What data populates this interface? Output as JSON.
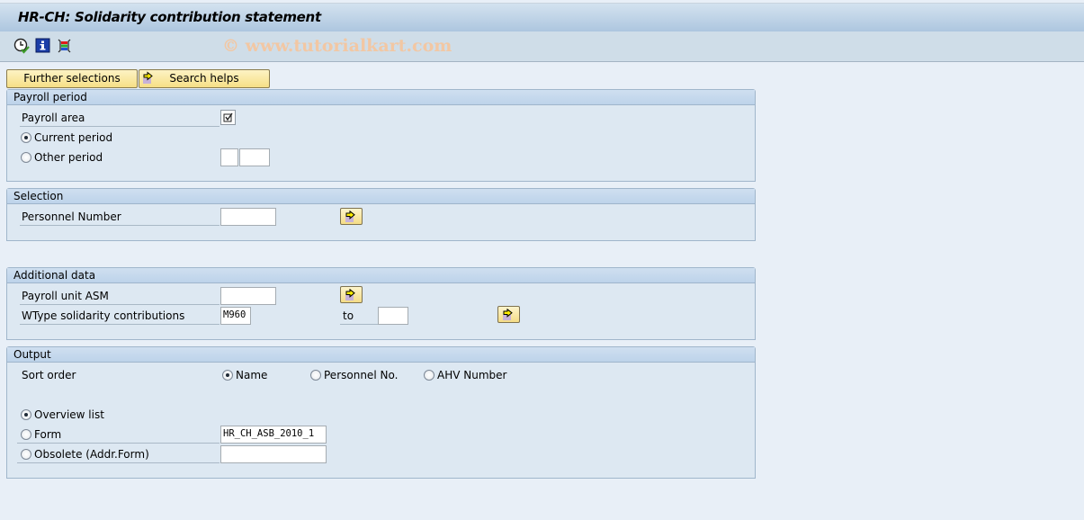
{
  "window": {
    "title": "HR-CH: Solidarity contribution statement",
    "watermark": "© www.tutorialkart.com"
  },
  "toolbar": {
    "icons": [
      "execute-clock-icon",
      "info-icon",
      "selection-options-icon"
    ]
  },
  "top_buttons": {
    "further_selections": "Further selections",
    "search_helps": "Search helps"
  },
  "payroll_period": {
    "header": "Payroll period",
    "payroll_area_label": "Payroll area",
    "payroll_area_checked": true,
    "current_period_label": "Current period",
    "current_period_selected": true,
    "other_period_label": "Other period",
    "other_period_selected": false,
    "other_period_value1": "",
    "other_period_value2": ""
  },
  "selection": {
    "header": "Selection",
    "personnel_number_label": "Personnel Number",
    "personnel_number_value": ""
  },
  "additional_data": {
    "header": "Additional data",
    "payroll_unit_label": "Payroll unit ASM",
    "payroll_unit_value": "",
    "wtype_label": "WType solidarity contributions",
    "wtype_from": "M960",
    "to_label": "to",
    "wtype_to": ""
  },
  "output": {
    "header": "Output",
    "sort_order_label": "Sort order",
    "sort_options": [
      {
        "label": "Name",
        "selected": true
      },
      {
        "label": "Personnel No.",
        "selected": false
      },
      {
        "label": "AHV Number",
        "selected": false
      }
    ],
    "overview_list_label": "Overview list",
    "overview_list_selected": true,
    "form_label": "Form",
    "form_selected": false,
    "form_value": "HR_CH_ASB_2010_1",
    "obsolete_label": "Obsolete (Addr.Form)",
    "obsolete_selected": false,
    "obsolete_value": ""
  }
}
